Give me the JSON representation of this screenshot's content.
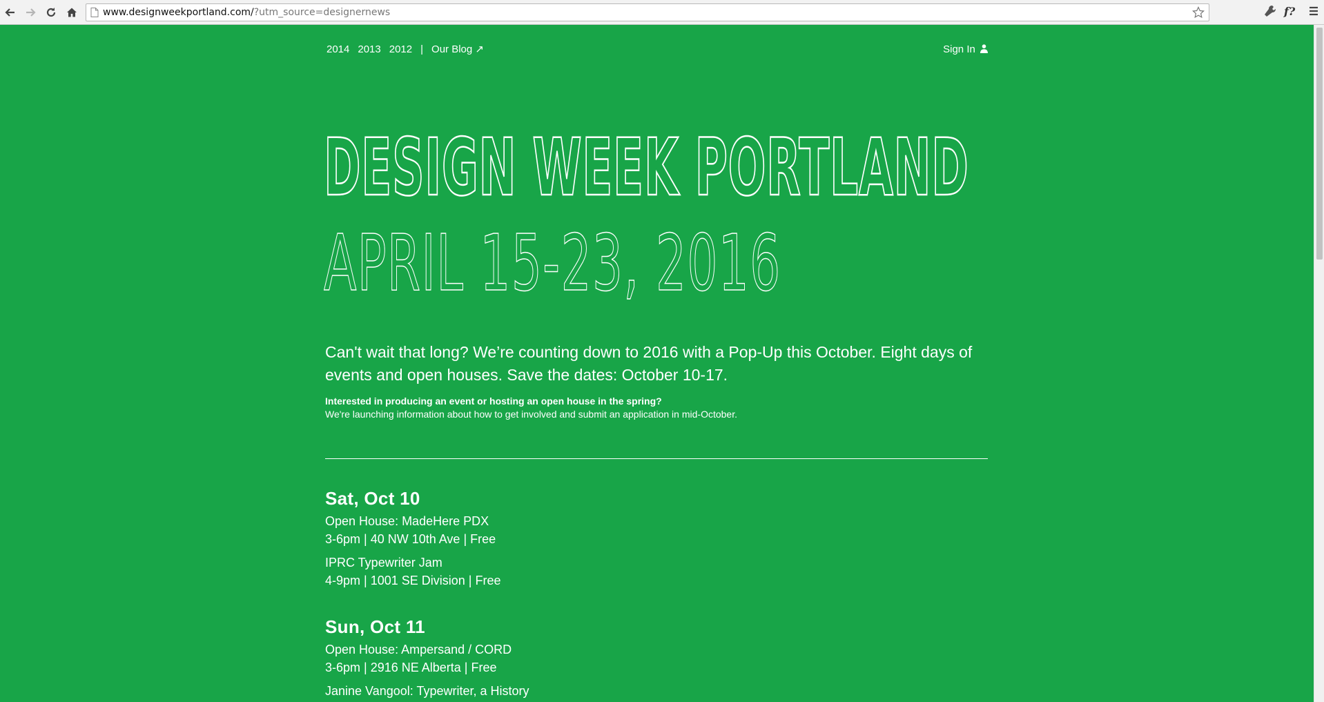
{
  "browser": {
    "url_host": "www.designweekportland.com/",
    "url_query": "?utm_source=designernews"
  },
  "topnav": {
    "years": [
      "2014",
      "2013",
      "2012"
    ],
    "separator": "|",
    "blog_label": "Our Blog ↗",
    "signin_label": "Sign In"
  },
  "hero": {
    "title": "DESIGN WEEK PORTLAND",
    "dates": "APRIL 15-23, 2016"
  },
  "intro": {
    "lead": "Can't wait that long? We’re counting down to 2016 with a Pop-Up this October. Eight days of events and open houses. Save the dates: October 10-17.",
    "question": "Interested in producing an event or hosting an open house in the spring?",
    "info": "We're launching information about how to get involved and submit an application in mid-October."
  },
  "schedule": [
    {
      "day": "Sat, Oct 10",
      "events": [
        {
          "title": "Open House: MadeHere PDX",
          "info": "3-6pm | 40 NW 10th Ave | Free"
        },
        {
          "title": "IPRC Typewriter Jam",
          "info": "4-9pm | 1001 SE Division | Free"
        }
      ]
    },
    {
      "day": "Sun, Oct 11",
      "events": [
        {
          "title": "Open House: Ampersand / CORD",
          "info": "3-6pm | 2916 NE Alberta | Free"
        },
        {
          "title": "Janine Vangool: Typewriter, a History",
          "info": ""
        }
      ]
    }
  ],
  "colors": {
    "background": "#18a548",
    "text": "#ffffff"
  }
}
